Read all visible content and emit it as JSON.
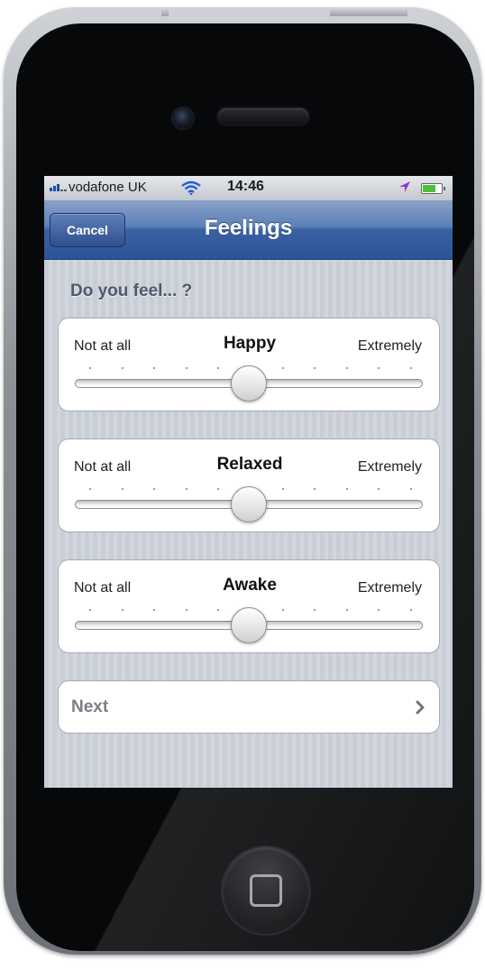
{
  "status_bar": {
    "carrier": "vodafone UK",
    "time": "14:46",
    "signal_bars": 3,
    "icons": [
      "signal-icon",
      "wifi-icon",
      "location-icon",
      "battery-icon"
    ],
    "battery_level": 0.8
  },
  "nav_bar": {
    "title": "Feelings",
    "cancel_label": "Cancel"
  },
  "section": {
    "header": "Do you feel... ?"
  },
  "sliders": [
    {
      "feeling": "Happy",
      "min_label": "Not at all",
      "max_label": "Extremely",
      "value": 0.5,
      "steps": 11
    },
    {
      "feeling": "Relaxed",
      "min_label": "Not at all",
      "max_label": "Extremely",
      "value": 0.5,
      "steps": 11
    },
    {
      "feeling": "Awake",
      "min_label": "Not at all",
      "max_label": "Extremely",
      "value": 0.5,
      "steps": 11
    }
  ],
  "next_row": {
    "label": "Next",
    "icon": "chevron-right-icon"
  },
  "colors": {
    "nav_bar": "#2c5396",
    "screen_background": "#cdd2d9",
    "section_header": "#4f5a6e",
    "card": "#ffffff"
  }
}
